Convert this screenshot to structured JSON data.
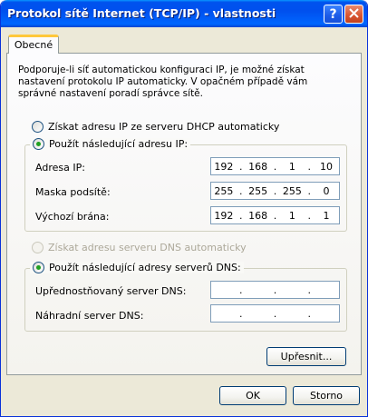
{
  "window": {
    "title": "Protokol sítě Internet (TCP/IP) - vlastnosti",
    "help_glyph": "?",
    "close_glyph": "✕"
  },
  "tabs": [
    {
      "label": "Obecné",
      "active": true
    }
  ],
  "description": "Podporuje-li síť automatickou konfiguraci IP, je možné získat nastavení protokolu IP automaticky. V opačném případě vám správné nastavení poradí správce sítě.",
  "ip_section": {
    "option_auto": {
      "label": "Získat adresu IP ze serveru DHCP automaticky",
      "selected": false
    },
    "option_manual": {
      "label": "Použít následující adresu IP:",
      "selected": true
    },
    "fields": {
      "ip": {
        "label": "Adresa IP:",
        "octets": [
          "192",
          "168",
          "1",
          "10"
        ]
      },
      "mask": {
        "label": "Maska podsítě:",
        "octets": [
          "255",
          "255",
          "255",
          "0"
        ]
      },
      "gateway": {
        "label": "Výchozí brána:",
        "octets": [
          "192",
          "168",
          "1",
          "1"
        ]
      }
    }
  },
  "dns_section": {
    "option_auto": {
      "label": "Získat adresu serveru DNS automaticky",
      "selected": false,
      "enabled": false
    },
    "option_manual": {
      "label": "Použít následující adresy serverů DNS:",
      "selected": true
    },
    "fields": {
      "preferred": {
        "label": "Upřednostňovaný server DNS:",
        "octets": [
          "",
          "",
          "",
          ""
        ]
      },
      "alternate": {
        "label": "Náhradní server DNS:",
        "octets": [
          "",
          "",
          "",
          ""
        ]
      }
    }
  },
  "buttons": {
    "advanced": "Upřesnit...",
    "ok": "OK",
    "cancel": "Storno"
  },
  "colors": {
    "titlebar": "#0054e3",
    "radio_checked": "#21a121",
    "window_bg": "#ece9d8"
  }
}
